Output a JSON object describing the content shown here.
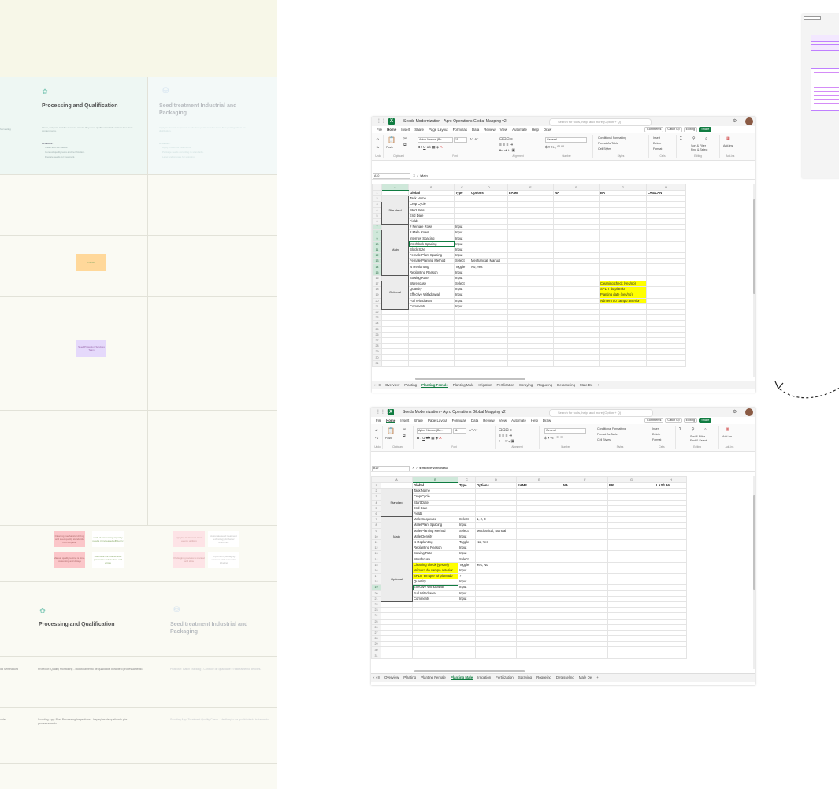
{
  "board": {
    "phases": [
      {
        "title": "Processing and Qualification",
        "description": "Clean, sort, and test the seeds to ensure they meet quality standards and are free from contaminants.",
        "activities_label": "Activities:",
        "activities": [
          "Clean and sort seeds.",
          "Conduct quality tests and certification.",
          "Prepare seeds for treatment."
        ],
        "icon": "seedling-hand-icon"
      },
      {
        "title": "Seed treatment Industrial and Packaging",
        "description": "Apply treatments to protect seeds from pests and diseases, then package them for distribution.",
        "activities_label": "Activities:",
        "activities": [
          "Apply protective treatments.",
          "Package seeds according to standards.",
          "Label and prepare for shipping."
        ],
        "icon": "jar-icon"
      }
    ],
    "left_fragment": "harvesting",
    "stickies": [
      {
        "text": "Planter",
        "color": "#ffd89a"
      },
      {
        "text": "Seed Protection Services Team",
        "color": "#e5d9fb"
      },
      {
        "text": "Cleaning mechanical drying and seed quality standards not complete",
        "color": "#fbc6c9"
      },
      {
        "text": "Lack of processing capacity results in increased efficiency",
        "color": "#ffffff"
      },
      {
        "text": "Manual quality testing is time-consuming and delays",
        "color": "#fbc6c9"
      },
      {
        "text": "Automate the qualification process to reduce time and errors",
        "color": "#ffffff"
      },
      {
        "text": "Applying treatments is not evenly uniform",
        "color": "#fde3e6"
      },
      {
        "text": "Automate seed treatment technology for better uniformity",
        "color": "#ffffff"
      },
      {
        "text": "Packaging process is manual and slow",
        "color": "#fde3e6"
      },
      {
        "text": "Implement packaging systems with automatic labeling",
        "color": "#ffffff"
      }
    ],
    "phases_repeat": [
      {
        "title": "Processing and Qualification",
        "icon": "seedling-hand-icon"
      },
      {
        "title": "Seed treatment Industrial and Packaging",
        "icon": "jar-icon"
      }
    ],
    "apps": [
      {
        "left": "Protector: Quality Monitoring - Monitoramento de qualidade durante o processamento.",
        "right": "Protector: Batch Tracking - Controle de qualidade e rastreamento de lotes.",
        "left_bold": "Protector:",
        "right_bold": "Protector:"
      },
      {
        "left": "Scouting App: Post-Processing Inspections - Inspeções de qualidade pós-processamento.",
        "right": "Scouting App: Treatment Quality Check - Verificação de qualidade do tratamento.",
        "left_bold": "Scouting App:",
        "right_bold": "Scouting App:"
      }
    ],
    "left_app_fragments": [
      "da Semeadura",
      "o de"
    ]
  },
  "excel1": {
    "title": "Seeds Modernization - Agro Operations Global Mapping v2",
    "search_placeholder": "Search for tools, help, and more (Option + Q)",
    "menu": [
      "File",
      "Home",
      "Insert",
      "Share",
      "Page Layout",
      "Formulas",
      "Data",
      "Review",
      "View",
      "Automate",
      "Help",
      "Draw"
    ],
    "menu_active": "Home",
    "buttons": [
      "Comments",
      "Catch up",
      "Editing",
      "Share"
    ],
    "ribbon": {
      "font_name": "Aptos Narrow (Bo...",
      "font_size": "11",
      "number_format": "General",
      "groups": [
        "Undo",
        "Clipboard",
        "Font",
        "Alignment",
        "Number",
        "Styles",
        "Cells",
        "Editing",
        "Add-ins"
      ],
      "styles": [
        "Conditional Formatting",
        "Format As Table",
        "Cell Styles"
      ],
      "cells": [
        "Insert",
        "Delete",
        "Format"
      ],
      "editing": [
        "Sort & Filter",
        "Find & Select"
      ],
      "paste": "Paste",
      "addins": "Add-ins"
    },
    "name_box": "A10",
    "formula_value": "Main",
    "columns": [
      "A",
      "B",
      "C",
      "D",
      "E",
      "F",
      "G",
      "H"
    ],
    "header_row": [
      "",
      "Global",
      "Type",
      "Options",
      "EAME",
      "NA",
      "BR",
      "LAS/LAN"
    ],
    "groups": {
      "standard": "Standard",
      "main": "Main",
      "optional": "Optional"
    },
    "rows": [
      [
        "Task Name",
        "",
        ""
      ],
      [
        "Crop Cycle",
        "",
        ""
      ],
      [
        "Start Date",
        "",
        ""
      ],
      [
        "End Date",
        "",
        ""
      ],
      [
        "Fields",
        "",
        ""
      ],
      [
        "# Female Rows",
        "Input",
        ""
      ],
      [
        "# Male Rows",
        "Input",
        ""
      ],
      [
        "Interrow Spacing",
        "Input",
        ""
      ],
      [
        "Interblock Spacing",
        "Input",
        ""
      ],
      [
        "Block Size",
        "Input",
        ""
      ],
      [
        "Female Plant Spacing",
        "Input",
        ""
      ],
      [
        "Female Planting Method",
        "Select",
        "Mechanical, Manual"
      ],
      [
        "Is Replanting",
        "Toggle",
        "No, Yes"
      ],
      [
        "Replanting Reason",
        "Input",
        ""
      ],
      [
        "Sowing Rate",
        "Input",
        ""
      ],
      [
        "Warehouse",
        "Select",
        ""
      ],
      [
        "Quantity",
        "Input",
        ""
      ],
      [
        "Effective Withdrawal",
        "Input",
        ""
      ],
      [
        "Full Withdrawal",
        "Input",
        ""
      ],
      [
        "Comments",
        "Input",
        ""
      ]
    ],
    "br_notes": [
      "Cleaning check (yes/no)",
      "SPLIT do plantio",
      "Planting date (yes/no)",
      "Número do campo anterior"
    ],
    "row_count": 31,
    "tabs": [
      "Overview",
      "Planting",
      "Planting Female",
      "Planting Male",
      "Irrigation",
      "Fertilization",
      "Spraying",
      "Rogueing",
      "Detasseling",
      "Male De"
    ],
    "active_tab": "Planting Female"
  },
  "excel2": {
    "title": "Seeds Modernization - Agro Operations Global Mapping v2",
    "search_placeholder": "Search for tools, help, and more (Option + Q)",
    "menu": [
      "File",
      "Home",
      "Insert",
      "Share",
      "Page Layout",
      "Formulas",
      "Data",
      "Review",
      "View",
      "Automate",
      "Help",
      "Draw"
    ],
    "menu_active": "Home",
    "buttons": [
      "Comments",
      "Catch up",
      "Editing",
      "Share"
    ],
    "ribbon": {
      "font_name": "Aptos Narrow (Bo...",
      "font_size": "11",
      "number_format": "General",
      "groups": [
        "Undo",
        "Clipboard",
        "Font",
        "Alignment",
        "Number",
        "Styles",
        "Cells",
        "Editing",
        "Add-ins"
      ],
      "styles": [
        "Conditional Formatting",
        "Format As Table",
        "Cell Styles"
      ],
      "cells": [
        "Insert",
        "Delete",
        "Format"
      ],
      "editing": [
        "Sort & Filter",
        "Find & Select"
      ],
      "paste": "Paste",
      "addins": "Add-ins"
    },
    "name_box": "B19",
    "formula_value": "Effective Withdrawal",
    "columns": [
      "A",
      "B",
      "C",
      "D",
      "E",
      "F",
      "G",
      "H"
    ],
    "header_row": [
      "",
      "Global",
      "Type",
      "Options",
      "EAME",
      "NA",
      "BR",
      "LAS/LAN"
    ],
    "groups": {
      "standard": "Standard",
      "main": "Main",
      "optional": "Optional"
    },
    "rows": [
      [
        "Task Name",
        "",
        ""
      ],
      [
        "Crop Cycle",
        "",
        ""
      ],
      [
        "Start Date",
        "",
        ""
      ],
      [
        "End Date",
        "",
        ""
      ],
      [
        "Fields",
        "",
        ""
      ],
      [
        "Male Sequence",
        "Select",
        "1, 2, 3"
      ],
      [
        "Male Plant Spacing",
        "Input",
        ""
      ],
      [
        "Male Planting Method",
        "Select",
        "Mechanical, Manual"
      ],
      [
        "Male Density",
        "Input",
        ""
      ],
      [
        "Is Replanting",
        "Toggle",
        "No, Yes"
      ],
      [
        "Replanting Reason",
        "Input",
        ""
      ],
      [
        "Sowing Rate",
        "Input",
        ""
      ],
      [
        "Warehouse",
        "Select",
        ""
      ],
      [
        "Cleaning check (yes/no)",
        "Toggle",
        "Yes, No"
      ],
      [
        "Número do campo anterior",
        "Input",
        ""
      ],
      [
        "SPLIT em que foi plantado",
        "?",
        ""
      ],
      [
        "Quantity",
        "Input",
        ""
      ],
      [
        "Effective Withdrawal",
        "Input",
        ""
      ],
      [
        "Full Withdrawal",
        "Input",
        ""
      ],
      [
        "Comments",
        "Input",
        ""
      ]
    ],
    "yellow_rows": [
      13,
      14,
      15
    ],
    "row_count": 31,
    "tabs": [
      "Overview",
      "Planting",
      "Planting Female",
      "Planting Male",
      "Irrigation",
      "Fertilization",
      "Spraying",
      "Rogueing",
      "Detasseling",
      "Male De"
    ],
    "active_tab": "Planting Male"
  },
  "colors": {
    "excel_green": "#107c41",
    "highlight": "#ffff00",
    "board_bg": "#fafaf3"
  },
  "icons": {
    "arrow": "dashed-curved-arrow-icon",
    "apps": "app-grid-icon",
    "settings": "gear-icon"
  }
}
